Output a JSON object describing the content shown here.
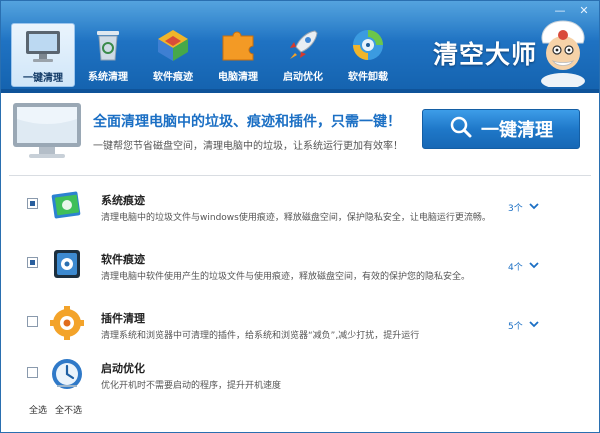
{
  "window": {
    "controls": {
      "minimize": "—",
      "close": "✕"
    }
  },
  "nav": {
    "items": [
      {
        "label": "一键清理",
        "icon": "monitor-icon",
        "active": true
      },
      {
        "label": "系统清理",
        "icon": "recycle-bin-icon",
        "active": false
      },
      {
        "label": "软件痕迹",
        "icon": "software-box-icon",
        "active": false
      },
      {
        "label": "电脑清理",
        "icon": "puzzle-icon",
        "active": false
      },
      {
        "label": "启动优化",
        "icon": "rocket-icon",
        "active": false
      },
      {
        "label": "软件卸载",
        "icon": "disc-icon",
        "active": false
      }
    ]
  },
  "brand": {
    "name": "清空大师",
    "mascot_icon": "doctor-mascot-icon"
  },
  "banner": {
    "title": "全面清理电脑中的垃圾、痕迹和插件，只需一键！",
    "subtitle": "一键帮您节省磁盘空间，清理电脑中的垃圾，让系统运行更加有效率！",
    "button_label": "一键清理",
    "button_icon": "search-icon"
  },
  "items": [
    {
      "title": "系统痕迹",
      "desc": "清理电脑中的垃圾文件与windows使用痕迹，释放磁盘空间，保护隐私安全，让电脑运行更流畅。",
      "count": "3个",
      "checked": true,
      "icon": "system-trace-icon"
    },
    {
      "title": "软件痕迹",
      "desc": "清理电脑中软件使用产生的垃圾文件与使用痕迹，释放磁盘空间，有效的保护您的隐私安全。",
      "count": "4个",
      "checked": true,
      "icon": "software-trace-icon"
    },
    {
      "title": "插件清理",
      "desc": "清理系统和浏览器中可清理的插件，给系统和浏览器“减负”,减少打扰，提升运行",
      "count": "5个",
      "checked": false,
      "icon": "plugin-gear-icon"
    },
    {
      "title": "启动优化",
      "desc": "优化开机时不需要启动的程序，提升开机速度",
      "count": "",
      "checked": false,
      "icon": "startup-optimize-icon"
    }
  ],
  "footer": {
    "select_all": "全选",
    "select_none": "全不选"
  },
  "colors": {
    "header_blue": "#1f72c2",
    "accent_blue": "#1b6fc4",
    "button_blue": "#1f78c9"
  }
}
